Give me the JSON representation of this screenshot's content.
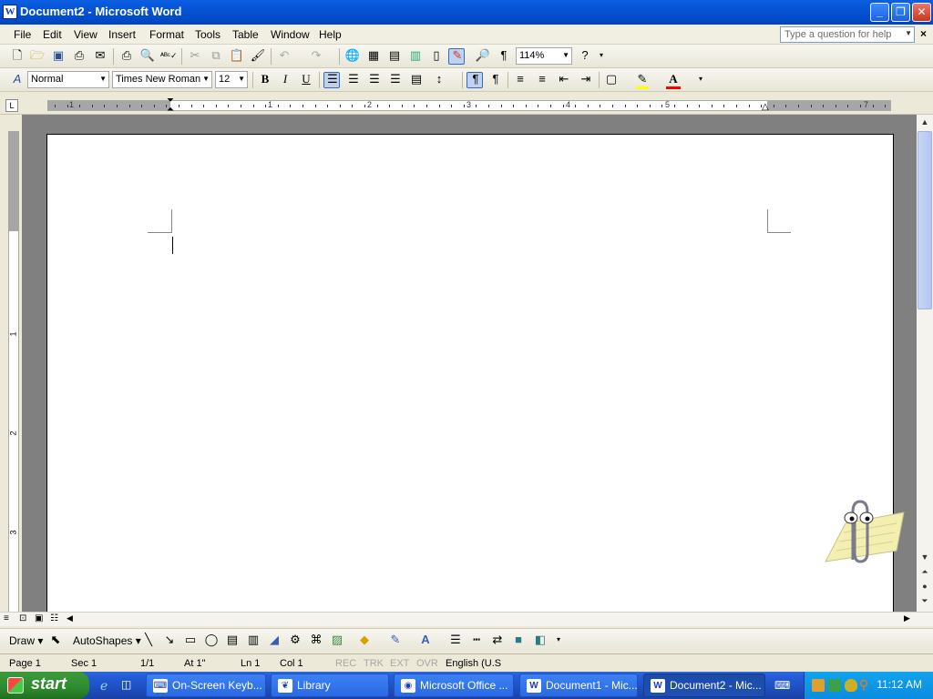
{
  "window": {
    "title": "Document2 - Microsoft Word"
  },
  "menu": [
    "File",
    "Edit",
    "View",
    "Insert",
    "Format",
    "Tools",
    "Table",
    "Window",
    "Help"
  ],
  "help_box": {
    "placeholder": "Type a question for help"
  },
  "standard_toolbar": {
    "zoom": "114%"
  },
  "formatting_toolbar": {
    "style": "Normal",
    "font": "Times New Roman",
    "size": "12",
    "highlight_color": "#ffff00",
    "font_color": "#ff0000"
  },
  "ruler": {
    "numbers": [
      "1",
      "1",
      "2",
      "3",
      "4",
      "5",
      "7"
    ]
  },
  "vertical_ruler": {
    "numbers": [
      "1",
      "2",
      "3"
    ]
  },
  "drawing_toolbar": {
    "draw_label": "Draw",
    "autoshapes_label": "AutoShapes"
  },
  "status": {
    "page": "Page  1",
    "sec": "Sec  1",
    "of": "1/1",
    "at": "At  1\"",
    "ln": "Ln  1",
    "col": "Col  1",
    "rec": "REC",
    "trk": "TRK",
    "ext": "EXT",
    "ovr": "OVR",
    "lang": "English (U.S"
  },
  "taskbar": {
    "start": "start",
    "items": [
      "On-Screen Keyb...",
      "Library",
      "Microsoft Office ...",
      "Document1 - Mic...",
      "Document2 - Mic..."
    ],
    "clock": "11:12 AM"
  },
  "colors": {
    "title": "#0054e3",
    "taskbar": "#245edb",
    "start": "#2e8a2e"
  }
}
